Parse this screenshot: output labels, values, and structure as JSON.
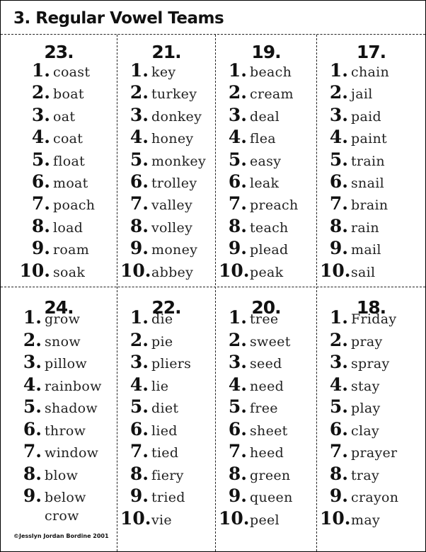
{
  "title": "3. Regular Vowel Teams",
  "copyright": "©Jesslyn Jordan Bordine 2001",
  "cells": [
    {
      "number": "23.",
      "words": [
        "coast",
        "boat",
        "oat",
        "coat",
        "float",
        "moat",
        "poach",
        "load",
        "roam",
        "soak"
      ]
    },
    {
      "number": "21.",
      "words": [
        "key",
        "turkey",
        "donkey",
        "honey",
        "monkey",
        "trolley",
        "valley",
        "volley",
        "money",
        "abbey"
      ]
    },
    {
      "number": "19.",
      "words": [
        "beach",
        "cream",
        "deal",
        "flea",
        "easy",
        "leak",
        "preach",
        "teach",
        "plead",
        "peak"
      ]
    },
    {
      "number": "17.",
      "words": [
        "chain",
        "jail",
        "paid",
        "paint",
        "train",
        "snail",
        "brain",
        "rain",
        "mail",
        "sail"
      ]
    },
    {
      "number": "24.",
      "words": [
        "grow",
        "snow",
        "pillow",
        "rainbow",
        "shadow",
        "throw",
        "window",
        "blow",
        "below",
        "crow"
      ],
      "unnumbered_last": true
    },
    {
      "number": "22.",
      "words": [
        "die",
        "pie",
        "pliers",
        "lie",
        "diet",
        "lied",
        "tied",
        "fiery",
        "tried",
        "vie"
      ]
    },
    {
      "number": "20.",
      "words": [
        "tree",
        "sweet",
        "seed",
        "need",
        "free",
        "sheet",
        "heed",
        "green",
        "queen",
        "peel"
      ]
    },
    {
      "number": "18.",
      "words": [
        "Friday",
        "pray",
        "spray",
        "stay",
        "play",
        "clay",
        "prayer",
        "tray",
        "crayon",
        "may"
      ]
    }
  ],
  "item_numbers": [
    "1.",
    "2.",
    "3.",
    "4.",
    "5.",
    "6.",
    "7.",
    "8.",
    "9.",
    "10."
  ]
}
